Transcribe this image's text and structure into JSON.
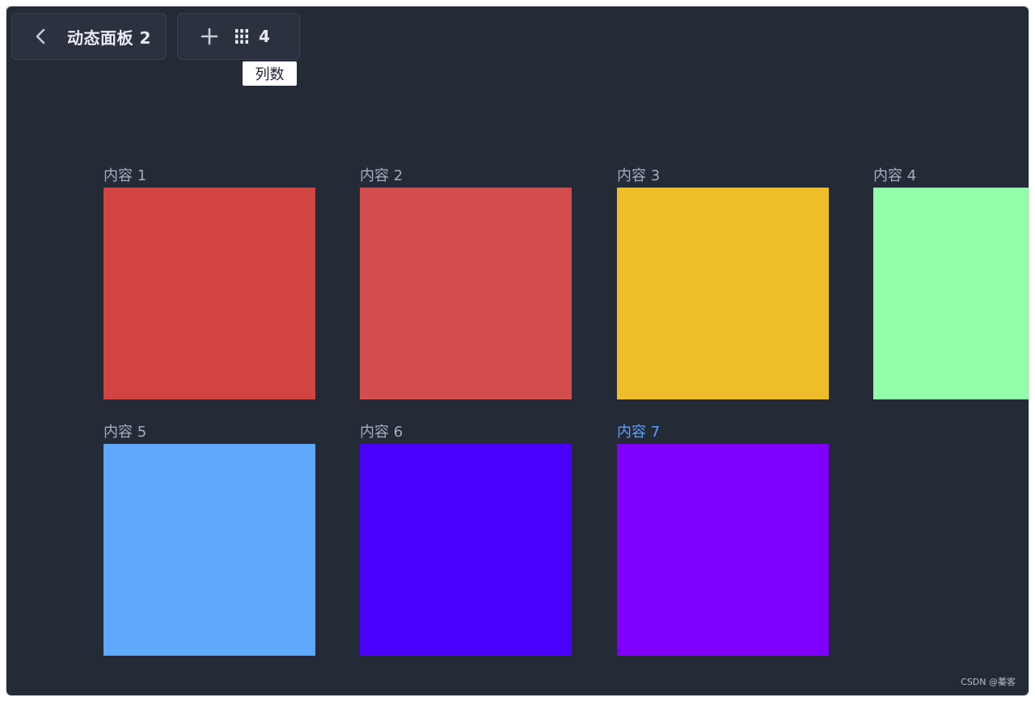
{
  "header": {
    "back_icon": "chevron-left-icon",
    "panel_title": "动态面板 2",
    "add_icon": "plus-icon",
    "columns_icon": "columns-grid-icon",
    "column_count": "4",
    "tooltip": "列数"
  },
  "grid": {
    "items": [
      {
        "label": "内容 1",
        "color": "#d24442",
        "active": false
      },
      {
        "label": "内容 2",
        "color": "#d44d4e",
        "active": false
      },
      {
        "label": "内容 3",
        "color": "#edbd2a",
        "active": false
      },
      {
        "label": "内容 4",
        "color": "#90ffa8",
        "active": false
      },
      {
        "label": "内容 5",
        "color": "#5fa8fc",
        "active": false
      },
      {
        "label": "内容 6",
        "color": "#4900fc",
        "active": false
      },
      {
        "label": "内容 7",
        "color": "#7e00fc",
        "active": true
      }
    ]
  },
  "watermark": "CSDN @蓁客"
}
